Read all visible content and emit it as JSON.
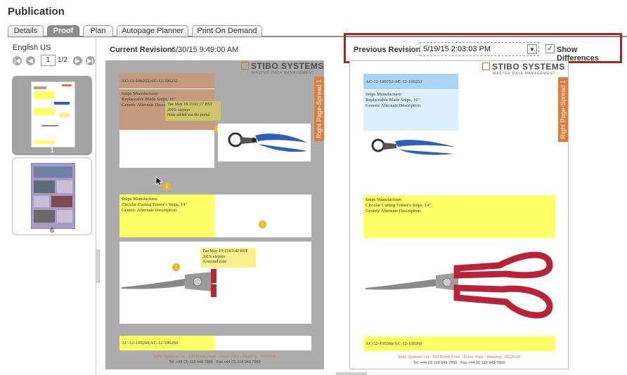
{
  "app": {
    "title": "Publication"
  },
  "tabs": [
    {
      "label": "Details",
      "active": false
    },
    {
      "label": "Proof",
      "active": true
    },
    {
      "label": "Plan",
      "active": false
    },
    {
      "label": "Autopage Planner",
      "active": false
    },
    {
      "label": "Print On Demand",
      "active": false
    }
  ],
  "left_panel": {
    "language": "English US",
    "pager": {
      "current_page": "1",
      "total": "1/2"
    },
    "thumbnails": [
      {
        "label": "1",
        "selected": true
      },
      {
        "label": "6",
        "selected": false
      }
    ]
  },
  "current_revision": {
    "label": "Current Revision:",
    "value": "6/30/15 9:49:00 AM"
  },
  "previous_revision": {
    "label": "Previous Revision:",
    "value": "5/19/15 2:03:03 PM"
  },
  "show_differences": {
    "label": "Show Differences",
    "checked": true
  },
  "pages": {
    "current": {
      "brand": "STIBO SYSTEMS",
      "brand_sub": "MASTER DATA MANAGEMENT",
      "spread_label": "Right Page-Spread 1",
      "id1": "AC-12-100252|AC-12-100252",
      "product1": [
        "Snips Manufacturer",
        "Replaceable Blade Snips, 16\"",
        "Generic Alternate Description"
      ],
      "note1": [
        "Tue May 19 15:01:27 BST",
        "2015: stepsys",
        "Note added via the portal"
      ],
      "product2": [
        "Snips Manufacturer",
        "Circular Cutting Tinner's Snips, 14\"",
        "Generic Alternate Description"
      ],
      "note2": [
        "Tue May 19 15:03:42 BST",
        "2015: stepsys",
        "A second note"
      ],
      "id2": "AC-12-100260|AC-12-100260",
      "footer1": "Stibo Systems Ltd  ·  200 Brook Drive  ·  Green Park  ·  Reading  ·  RG26UB",
      "footer2": "Tel. +44 (0) 118 949 7899  ·  Fax +44 (0) 118 949 7869"
    },
    "previous": {
      "brand": "STIBO SYSTEMS",
      "brand_sub": "MASTER DATA MANAGEMENT",
      "spread_label": "Right Page-Spread 1",
      "id1": "AC-12-100252/AC-12-100252",
      "product1": [
        "Snips Manufacturer",
        "Replaceable Blade Snips, 16\"",
        "Generic Alternate Description"
      ],
      "product2": [
        "Snips Manufacturer",
        "Circular Cutting Tinner's Snips, 14\"",
        "Generic Alternate Description"
      ],
      "id2": "AC-12-100260/AC-12-100260",
      "footer1": "Stibo Systems Ltd  ·  200 Brook Drive  ·  Green Park  ·  Reading  ·  RG26UB",
      "footer2": "Tel. +44 (0) 118 949 7899  ·  Fax +44 (0) 118 949 7869"
    }
  },
  "colors": {
    "highlight_box": "#a02828",
    "spread_tab": "#e37c3a",
    "diff_yellow": "#ffff66",
    "diff_tan": "#c49b7f",
    "diff_blue": "#a9d6f7",
    "handle_blue": "#2f5fb8",
    "handle_red": "#b8233a"
  }
}
